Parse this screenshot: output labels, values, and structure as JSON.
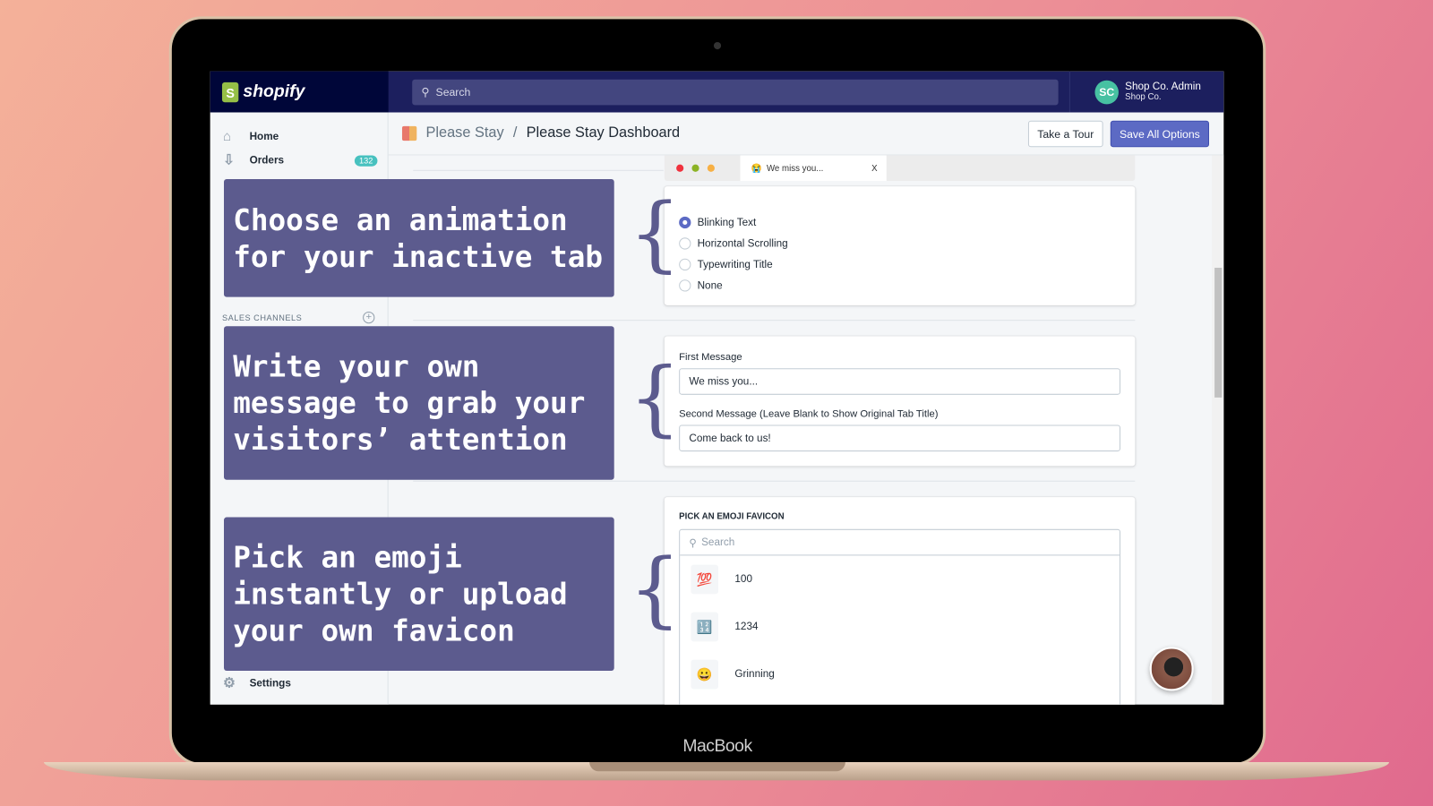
{
  "device": {
    "brand": "MacBook"
  },
  "topbar": {
    "logo": "shopify",
    "search_placeholder": "Search",
    "user": {
      "initials": "SC",
      "name": "Shop Co. Admin",
      "shop": "Shop Co."
    }
  },
  "sidebar": {
    "items": [
      {
        "label": "Home",
        "icon": "home-icon"
      },
      {
        "label": "Orders",
        "icon": "orders-icon",
        "badge": "132"
      }
    ],
    "section": "SALES CHANNELS",
    "settings": "Settings"
  },
  "header": {
    "breadcrumb_parent": "Please Stay",
    "separator": "/",
    "title": "Please Stay Dashboard",
    "take_tour": "Take a Tour",
    "save": "Save All Options"
  },
  "browser_tab": {
    "emoji": "😭",
    "title": "We miss you...",
    "close": "X"
  },
  "animation": {
    "options": [
      "Blinking Text",
      "Horizontal Scrolling",
      "Typewriting Title",
      "None"
    ],
    "selected": "Blinking Text"
  },
  "messages": {
    "first_label": "First Message",
    "first_value": "We miss you...",
    "second_label": "Second Message (Leave Blank to Show Original Tab Title)",
    "second_value": "Come back to us!"
  },
  "emoji": {
    "heading": "PICK AN EMOJI FAVICON",
    "search_placeholder": "Search",
    "items": [
      {
        "icon": "💯",
        "label": "100"
      },
      {
        "icon": "🔢",
        "label": "1234"
      },
      {
        "icon": "😀",
        "label": "Grinning"
      }
    ]
  },
  "overlays": [
    "Choose an animation for your inactive tab",
    "Write your own message to grab your visitors’ attention",
    "Pick an emoji instantly or upload your own favicon"
  ],
  "colors": {
    "topbar": "#1c1f5e",
    "accent": "#5c6ac4",
    "overlay": "#5c5b8e",
    "badge": "#47c1bf"
  }
}
